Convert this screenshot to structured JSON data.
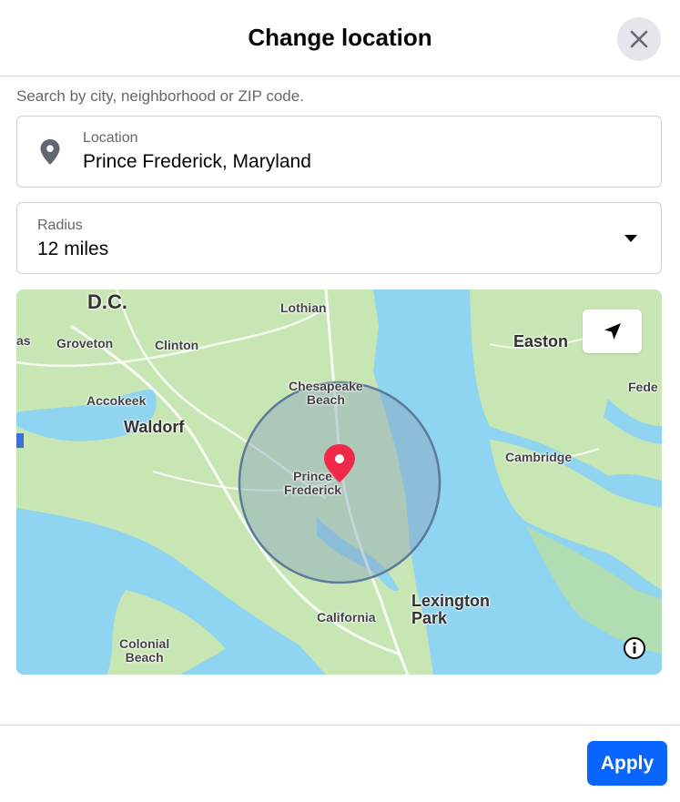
{
  "dialog": {
    "title": "Change location",
    "close_icon": "close-icon"
  },
  "search": {
    "hint": "Search by city, neighborhood or ZIP code."
  },
  "location": {
    "label": "Location",
    "value": "Prince Frederick, Maryland",
    "icon": "map-pin-icon"
  },
  "radius": {
    "label": "Radius",
    "value": "12 miles",
    "icon": "caret-down-icon"
  },
  "map": {
    "water_color": "#8fd4f0",
    "land_color": "#c8e6b4",
    "radius_circle_color": "#5c7a99",
    "marker_color": "#f02849",
    "locate_icon": "navigation-arrow-icon",
    "info_icon": "info-icon",
    "place_labels": {
      "dc": "D.C.",
      "lothian": "Lothian",
      "as": "as",
      "groveton": "Groveton",
      "clinton": "Clinton",
      "easton": "Easton",
      "chesapeake_beach_1": "Chesapeake",
      "chesapeake_beach_2": "Beach",
      "fede": "Fede",
      "accokeek": "Accokeek",
      "waldorf": "Waldorf",
      "prince_frederick_1": "Prince",
      "prince_frederick_2": "Frederick",
      "cambridge": "Cambridge",
      "lexington_park_1": "Lexington",
      "lexington_park_2": "Park",
      "california": "California",
      "colonial_beach_1": "Colonial",
      "colonial_beach_2": "Beach"
    }
  },
  "footer": {
    "apply_label": "Apply",
    "accent_color": "#0866ff"
  }
}
